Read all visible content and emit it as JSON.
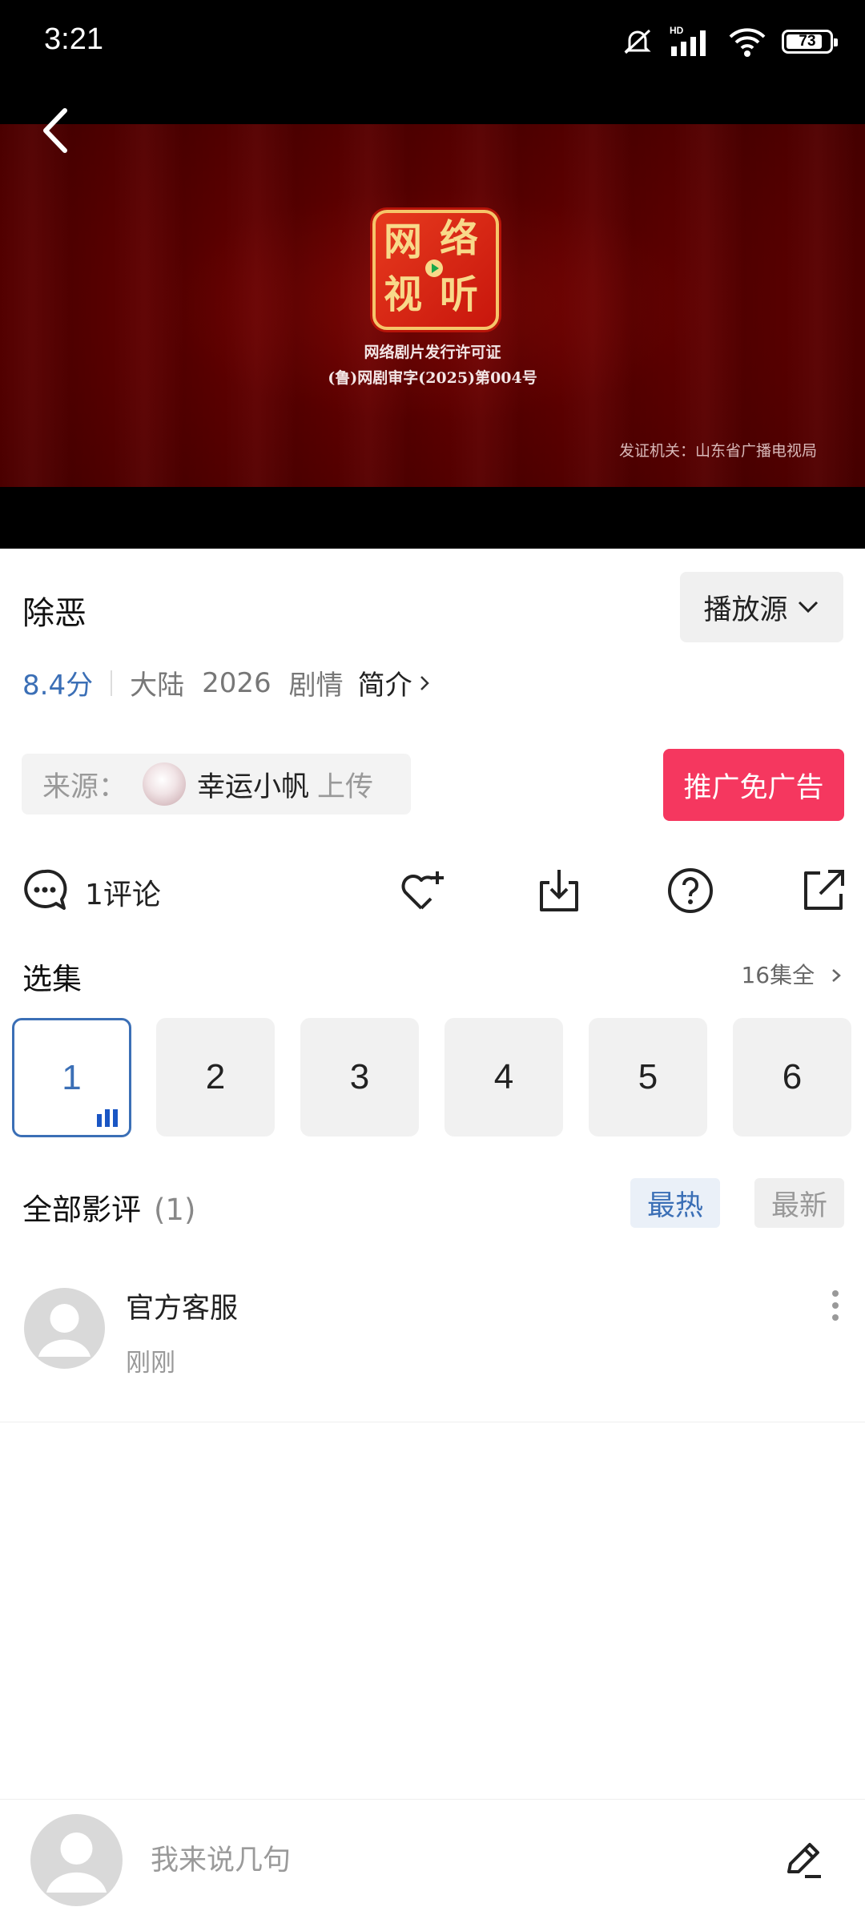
{
  "status": {
    "time": "3:21",
    "battery": "73",
    "network_label": "HD"
  },
  "video": {
    "seal_chars": [
      "网",
      "络",
      "视",
      "听"
    ],
    "license_line1": "网络剧片发行许可证",
    "license_line2": "(鲁)网剧审字(2025)第004号",
    "issuer": "发证机关：山东省广播电视局"
  },
  "info": {
    "title": "除恶",
    "source_button": "播放源",
    "score": "8.4分",
    "region": "大陆",
    "year": "2026",
    "genre": "剧情",
    "intro": "简介"
  },
  "uploader": {
    "label": "来源：",
    "name": "幸运小帆",
    "suffix": "上传"
  },
  "promo_button": "推广免广告",
  "actions": {
    "comments": "1评论",
    "icons": [
      "comment-icon",
      "favorite-add-icon",
      "download-icon",
      "help-icon",
      "share-icon"
    ]
  },
  "episodes": {
    "title": "选集",
    "all_label": "16集全",
    "items": [
      "1",
      "2",
      "3",
      "4",
      "5",
      "6"
    ],
    "active": 0
  },
  "reviews": {
    "title": "全部影评",
    "count": "(1)",
    "tab_hot": "最热",
    "tab_new": "最新",
    "items": [
      {
        "name": "官方客服",
        "time": "刚刚"
      }
    ]
  },
  "composer": {
    "placeholder": "我来说几句"
  },
  "colors": {
    "accent_blue": "#3b6fb6",
    "promo_red": "#f5375f",
    "video_red": "#5a0000"
  }
}
